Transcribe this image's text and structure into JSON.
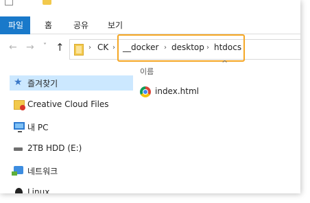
{
  "ribbon": {
    "tabs": [
      "파일",
      "홈",
      "공유",
      "보기"
    ]
  },
  "address": {
    "crumbs": [
      "CK",
      "__docker",
      "desktop",
      "htdocs"
    ],
    "separator": "›",
    "highlight_color": "#f5a623"
  },
  "nav_buttons": {
    "back": "←",
    "forward": "→",
    "recent": "˅",
    "up": "↑"
  },
  "sidebar": {
    "items": [
      {
        "label": "즐겨찾기",
        "icon": "star-icon",
        "selected": true
      },
      {
        "label": "Creative Cloud Files",
        "icon": "creative-cloud-folder-icon"
      },
      {
        "label": "내 PC",
        "icon": "computer-icon"
      },
      {
        "label": "2TB HDD (E:)",
        "icon": "drive-icon"
      },
      {
        "label": "네트워크",
        "icon": "network-icon"
      },
      {
        "label": "Linux",
        "icon": "linux-icon"
      }
    ]
  },
  "content": {
    "column_header": "이름",
    "sort_indicator": "^",
    "files": [
      {
        "name": "index.html",
        "icon": "chrome-icon"
      }
    ]
  },
  "colors": {
    "file_tab": "#1979ca",
    "selected_item": "#cce8ff"
  }
}
